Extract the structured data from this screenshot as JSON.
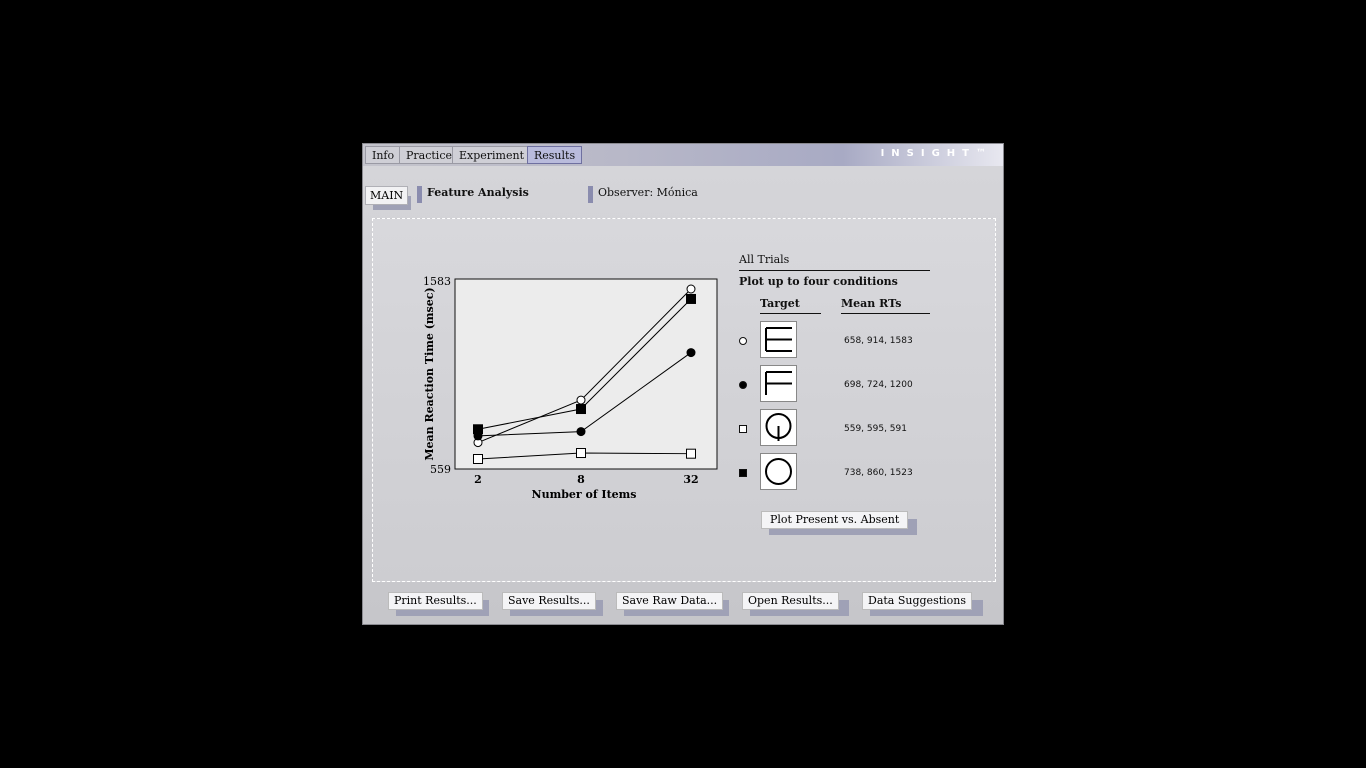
{
  "tabs": [
    {
      "label": "Info"
    },
    {
      "label": "Practice"
    },
    {
      "label": "Experiment"
    },
    {
      "label": "Results"
    }
  ],
  "logo": "INSIGHT™",
  "main_button": "MAIN",
  "section_title": "Feature Analysis",
  "observer": "Observer: Mónica",
  "side": {
    "all_trials": "All Trials",
    "plot_upto": "Plot up to four conditions",
    "col_target": "Target",
    "col_rts": "Mean RTs"
  },
  "conditions": [
    {
      "marker": "open-circle",
      "icon": "E-shape-icon",
      "rts": "658, 914, 1583"
    },
    {
      "marker": "filled-circle",
      "icon": "F-shape-icon",
      "rts": "698, 724, 1200"
    },
    {
      "marker": "open-square",
      "icon": "circle-with-line-icon",
      "rts": "559, 595, 591"
    },
    {
      "marker": "filled-square",
      "icon": "circle-icon",
      "rts": "738, 860, 1523"
    }
  ],
  "plot_button": "Plot Present vs. Absent",
  "bottom_buttons": [
    {
      "label": "Print Results..."
    },
    {
      "label": "Save Results..."
    },
    {
      "label": "Save Raw Data..."
    },
    {
      "label": "Open Results..."
    },
    {
      "label": "Data Suggestions"
    }
  ],
  "chart_data": {
    "type": "line",
    "xlabel": "Number of Items",
    "ylabel": "Mean Reaction Time (msec)",
    "categories": [
      2,
      8,
      32
    ],
    "ylim": [
      559,
      1583
    ],
    "y_tick_labels": [
      "559",
      "1583"
    ],
    "series": [
      {
        "marker": "open-circle",
        "values": [
          658,
          914,
          1583
        ]
      },
      {
        "marker": "filled-circle",
        "values": [
          698,
          724,
          1200
        ]
      },
      {
        "marker": "open-square",
        "values": [
          559,
          595,
          591
        ]
      },
      {
        "marker": "filled-square",
        "values": [
          738,
          860,
          1523
        ]
      }
    ]
  }
}
